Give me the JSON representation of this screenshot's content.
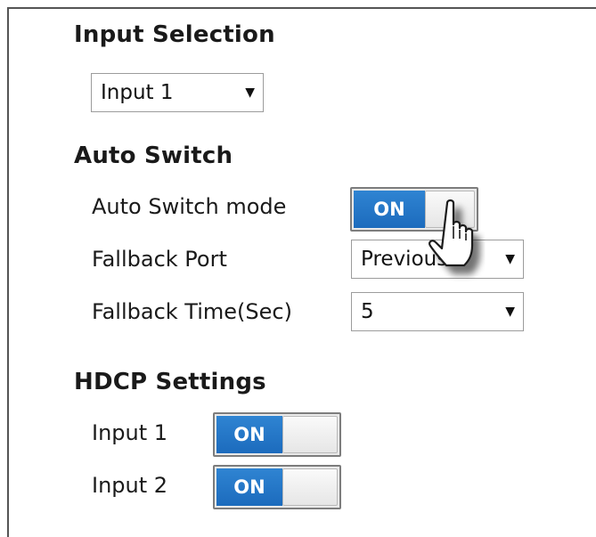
{
  "input_selection": {
    "title": "Input Selection",
    "selected": "Input 1"
  },
  "auto_switch": {
    "title": "Auto Switch",
    "mode_label": "Auto Switch mode",
    "mode_toggle": "ON",
    "fallback_port_label": "Fallback Port",
    "fallback_port_value": "Previous",
    "fallback_time_label": "Fallback Time(Sec)",
    "fallback_time_value": "5"
  },
  "hdcp": {
    "title": "HDCP Settings",
    "input1_label": "Input 1",
    "input1_toggle": "ON",
    "input2_label": "Input 2",
    "input2_toggle": "ON"
  },
  "icons": {
    "select_arrow": "triangle-down-icon",
    "pointer": "hand-pointer-icon"
  },
  "colors": {
    "toggle_on": "#2a7fd0",
    "border": "#9c9c9c"
  }
}
